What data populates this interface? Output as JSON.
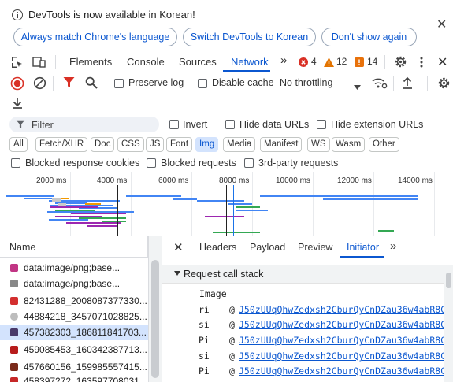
{
  "infobar": {
    "message": "DevTools is now available in Korean!",
    "buttons": [
      "Always match Chrome's language",
      "Switch DevTools to Korean",
      "Don't show again"
    ],
    "close_glyph": "✕"
  },
  "main_tabs": {
    "items": [
      "Elements",
      "Console",
      "Sources",
      "Network"
    ],
    "active": "Network",
    "more_glyph": "»",
    "errors": "4",
    "warnings": "12",
    "issues": "14"
  },
  "toolbar": {
    "preserve_log": "Preserve log",
    "disable_cache": "Disable cache",
    "throttling": "No throttling"
  },
  "filter": {
    "placeholder": "Filter",
    "invert": "Invert",
    "hide_data_urls": "Hide data URLs",
    "hide_extension_urls": "Hide extension URLs"
  },
  "type_filters": [
    "All",
    "Fetch/XHR",
    "Doc",
    "CSS",
    "JS",
    "Font",
    "Img",
    "Media",
    "Manifest",
    "WS",
    "Wasm",
    "Other"
  ],
  "type_filter_active": "Img",
  "blocked": {
    "cookies": "Blocked response cookies",
    "requests": "Blocked requests",
    "third_party": "3rd-party requests"
  },
  "timeline": {
    "ticks": [
      "2000 ms",
      "4000 ms",
      "6000 ms",
      "8000 ms",
      "10000 ms",
      "12000 ms",
      "14000 ms"
    ]
  },
  "requests": {
    "header": "Name",
    "rows": [
      {
        "name": "data:image/png;base...",
        "color": "#c13584"
      },
      {
        "name": "data:image/png;base...",
        "color": "#888888"
      },
      {
        "name": "82431288_2008087377330...",
        "color": "#d32f2f"
      },
      {
        "name": "44884218_3457071028825...",
        "color": "#bdbdbd"
      },
      {
        "name": "457382303_186811841703...",
        "color": "#4a3a6a"
      },
      {
        "name": "459085453_160342387713...",
        "color": "#b71c1c"
      },
      {
        "name": "457660156_159985557415...",
        "color": "#7a2a1a"
      },
      {
        "name": "458397272_163597708031...",
        "color": "#c62828"
      }
    ],
    "selected_index": 4
  },
  "detail": {
    "tabs": [
      "Headers",
      "Payload",
      "Preview",
      "Initiator"
    ],
    "active": "Initiator",
    "more_glyph": "»",
    "close_glyph": "✕",
    "section_title": "Request call stack",
    "stack_label": "Image",
    "frames": [
      {
        "fn": "ri",
        "at": "@",
        "link": "J50zUUqQhwZedxsh2CburQyCnDZau36w4abR8CoJ2Ct"
      },
      {
        "fn": "si",
        "at": "@",
        "link": "J50zUUqQhwZedxsh2CburQyCnDZau36w4abR8CoJ2Ct"
      },
      {
        "fn": "Pi",
        "at": "@",
        "link": "J50zUUqQhwZedxsh2CburQyCnDZau36w4abR8CoJ2Ct"
      },
      {
        "fn": "si",
        "at": "@",
        "link": "J50zUUqQhwZedxsh2CburQyCnDZau36w4abR8CoJ2Ct"
      },
      {
        "fn": "Pi",
        "at": "@",
        "link": "J50zUUqQhwZedxsh2CburQyCnDZau36w4abR8CoJ2Ct"
      }
    ]
  },
  "colors": {
    "accent": "#0b57d0",
    "record_red": "#d93025",
    "filter_red": "#d93025",
    "selected_bg": "#d3e3fd",
    "error_red": "#d93025",
    "warning_orange": "#e37400",
    "issue_orange": "#e8710a"
  }
}
